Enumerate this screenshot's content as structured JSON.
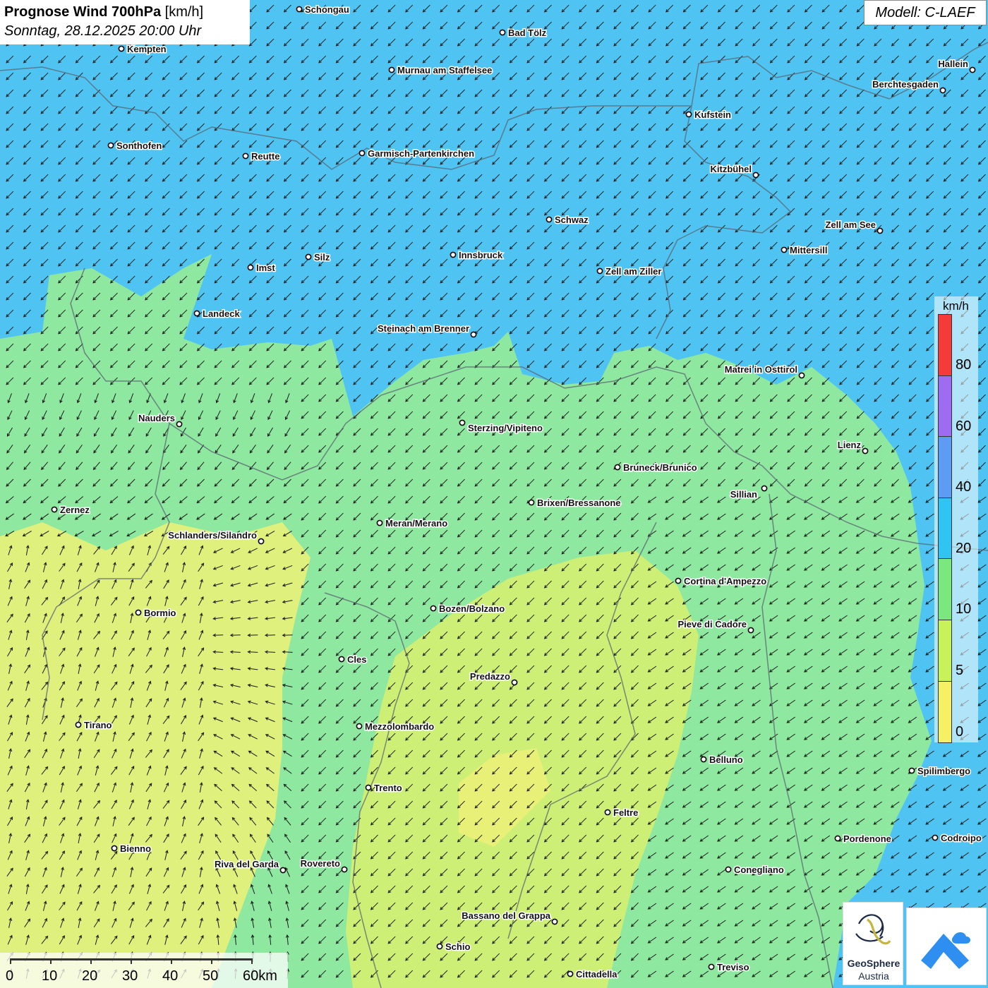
{
  "header": {
    "title_bold": "Prognose Wind 700hPa",
    "title_unit": "[km/h]",
    "datetime": "Sonntag, 28.12.2025 20:00 Uhr"
  },
  "model_label": "Modell: C-LAEF",
  "legend": {
    "unit": "km/h",
    "ticks": [
      "80",
      "60",
      "40",
      "20",
      "10",
      "5",
      "0"
    ],
    "colors": [
      "#f53a3a",
      "#9d6cf0",
      "#5d9cf2",
      "#2fc4f2",
      "#7be87f",
      "#c8f25a",
      "#f5f064"
    ]
  },
  "scalebar": {
    "labels": [
      "0",
      "10",
      "20",
      "30",
      "40",
      "50",
      "60km"
    ]
  },
  "logo": {
    "name_line1": "GeoSphere",
    "name_line2": "Austria"
  },
  "map_colors": {
    "wind_10_20": "#4fc4f2",
    "wind_5_10": "#8ee8a0",
    "wind_0_5": "#e6f07a"
  },
  "cities": [
    {
      "name": "Schongau"
    },
    {
      "name": "Bad Tölz"
    },
    {
      "name": "Kempten"
    },
    {
      "name": "Murnau am Staffelsee"
    },
    {
      "name": "Hallein"
    },
    {
      "name": "Berchtesgaden"
    },
    {
      "name": "Kufstein"
    },
    {
      "name": "Sonthofen"
    },
    {
      "name": "Reutte"
    },
    {
      "name": "Garmisch-Partenkirchen"
    },
    {
      "name": "Kitzbühel"
    },
    {
      "name": "Schwaz"
    },
    {
      "name": "Zell am See"
    },
    {
      "name": "Mittersill"
    },
    {
      "name": "Imst"
    },
    {
      "name": "Silz"
    },
    {
      "name": "Innsbruck"
    },
    {
      "name": "Zell am Ziller"
    },
    {
      "name": "Landeck"
    },
    {
      "name": "Steinach am Brenner"
    },
    {
      "name": "Matrei in Osttirol"
    },
    {
      "name": "Nauders"
    },
    {
      "name": "Sterzing/Vipiteno"
    },
    {
      "name": "Lienz"
    },
    {
      "name": "Bruneck/Brunico"
    },
    {
      "name": "Sillian"
    },
    {
      "name": "Zernez"
    },
    {
      "name": "Brixen/Bressanone"
    },
    {
      "name": "Meran/Merano"
    },
    {
      "name": "Schlanders/Silandro"
    },
    {
      "name": "Cortina d'Ampezzo"
    },
    {
      "name": "Bozen/Bolzano"
    },
    {
      "name": "Bormio"
    },
    {
      "name": "Pieve di Cadore"
    },
    {
      "name": "Cles"
    },
    {
      "name": "Predazzo"
    },
    {
      "name": "Tirano"
    },
    {
      "name": "Mezzolombardo"
    },
    {
      "name": "Belluno"
    },
    {
      "name": "Spilimbergo"
    },
    {
      "name": "Trento"
    },
    {
      "name": "Feltre"
    },
    {
      "name": "Pordenone"
    },
    {
      "name": "Codroipo"
    },
    {
      "name": "Bienno"
    },
    {
      "name": "Riva del Garda"
    },
    {
      "name": "Rovereto"
    },
    {
      "name": "Conegliano"
    },
    {
      "name": "Bassano del Grappa"
    },
    {
      "name": "Schio"
    },
    {
      "name": "Treviso"
    },
    {
      "name": "Cittadella"
    }
  ]
}
